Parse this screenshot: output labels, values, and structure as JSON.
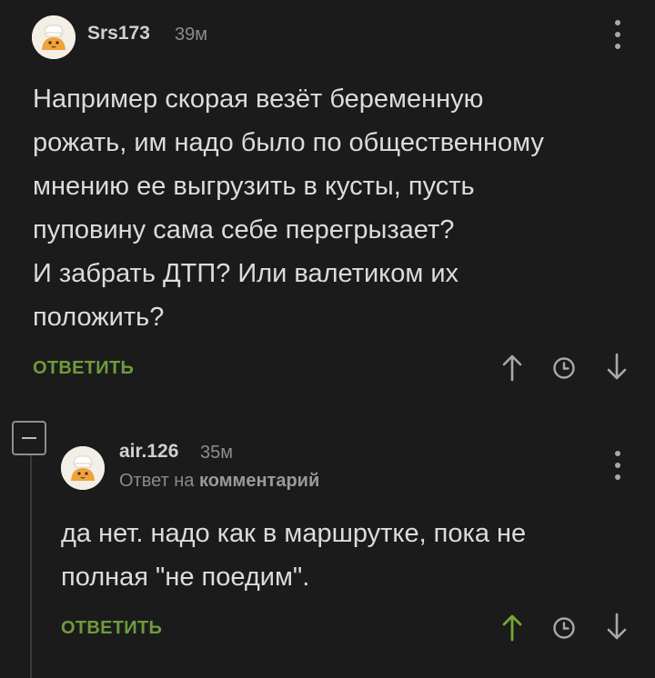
{
  "comments": [
    {
      "username": "Srs173",
      "time": "39м",
      "lines": [
        "Например скорая везёт беременную",
        "рожать, им надо было по общественному",
        "мнению ее выгрузить в кусты, пусть",
        "пуповину сама себе перегрызает?",
        "И забрать ДТП? Или валетиком их",
        "положить?"
      ],
      "reply_label": "ОТВЕТИТЬ"
    },
    {
      "username": "air.126",
      "time": "35м",
      "reply_to_prefix": "Ответ на",
      "reply_to_target": "комментарий",
      "lines": [
        "да нет. надо как в маршрутке, пока не",
        "полная \"не поедим\"."
      ],
      "reply_label": "ОТВЕТИТЬ",
      "upvoted": true
    }
  ],
  "icons": {
    "upvote": "arrow-up-icon",
    "save": "clock-icon",
    "downvote": "arrow-down-icon",
    "more": "more-vertical-icon",
    "collapse": "collapse-minus-icon"
  },
  "colors": {
    "background": "#1b1b1b",
    "accent_green": "#6e9b3d",
    "upvote_active": "#73a934",
    "text": "#dcdcdc",
    "muted": "#8c8c8c"
  }
}
